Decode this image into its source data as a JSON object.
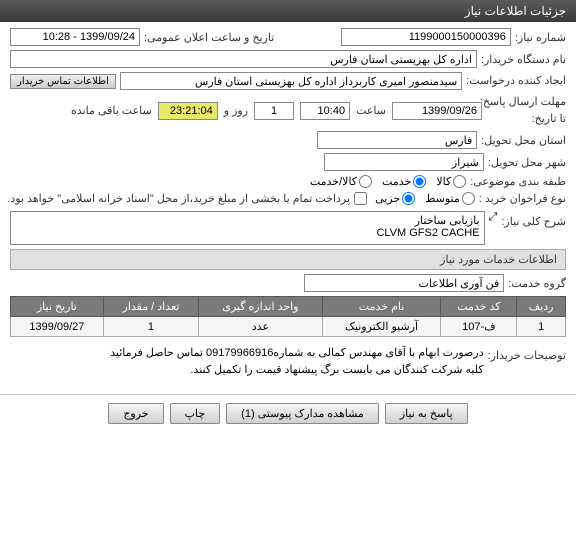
{
  "header": {
    "title": "جزئیات اطلاعات نیاز"
  },
  "need_number": {
    "label": "شماره نیاز:",
    "value": "1199000150000396"
  },
  "announce": {
    "label": "تاریخ و ساعت اعلان عمومی:",
    "value": "1399/09/24 - 10:28"
  },
  "org": {
    "label": "نام دستگاه خریدار:",
    "value": "اداره کل بهزیستی استان فارس"
  },
  "creator": {
    "label": "ایجاد کننده درخواست:",
    "value": "سیدمنصور امیری کاربرداز اداره کل بهزیستی استان فارس",
    "btn": "اطلاعات تماس خریدار"
  },
  "deadline": {
    "label": "مهلت ارسال پاسخ:",
    "to_label": "تا تاریخ:",
    "date": "1399/09/26",
    "time_label": "ساعت",
    "time": "10:40",
    "day_count": "1",
    "day_label": "روز و",
    "countdown": "23:21:04",
    "remain": "ساعت باقی مانده"
  },
  "province": {
    "label": "استان محل تحویل:",
    "value": "فارس"
  },
  "city": {
    "label": "شهر محل تحویل:",
    "value": "شیراز"
  },
  "category": {
    "label": "طبقه بندی موضوعی:",
    "options": [
      {
        "label": "کالا",
        "checked": false
      },
      {
        "label": "خدمت",
        "checked": true
      },
      {
        "label": "کالا/خدمت",
        "checked": false
      }
    ]
  },
  "purchase_type": {
    "label": "نوع فراخوان خرید :",
    "options": [
      {
        "label": "متوسط",
        "checked": false
      },
      {
        "label": "جزیی",
        "checked": true
      }
    ],
    "note_checkbox": false,
    "note": "پرداخت تمام یا بخشی از مبلغ خرید،از محل \"اسناد خزانه اسلامی\" خواهد بود."
  },
  "description": {
    "label": "شرح کلی نیاز:",
    "expand": "⤢",
    "text": "بازیابی ساختار\nCLVM GFS2 CACHE"
  },
  "section2": "اطلاعات خدمات مورد نیاز",
  "service_group": {
    "label": "گروه خدمت:",
    "value": "فن آوری اطلاعات"
  },
  "table": {
    "headers": [
      "ردیف",
      "کد خدمت",
      "نام خدمت",
      "واحد اندازه گیری",
      "تعداد / مقدار",
      "تاریخ نیاز"
    ],
    "row": [
      "1",
      "ف-107",
      "آرشیو الکترونیک",
      "عدد",
      "1",
      "1399/09/27"
    ]
  },
  "buyer_notes": {
    "label": "توضیحات خریدار:",
    "text": "درصورت ابهام با آقای مهندس کمالی به شماره09179966916 تماس حاصل فرمائید\nکلیه شرکت کنندگان می بایست برگ پیشنهاد قیمت را تکمیل کنند."
  },
  "footer": {
    "reply": "پاسخ به نیاز",
    "attachments": "مشاهده مدارک پیوستی (1)",
    "print": "چاپ",
    "exit": "خروج"
  }
}
